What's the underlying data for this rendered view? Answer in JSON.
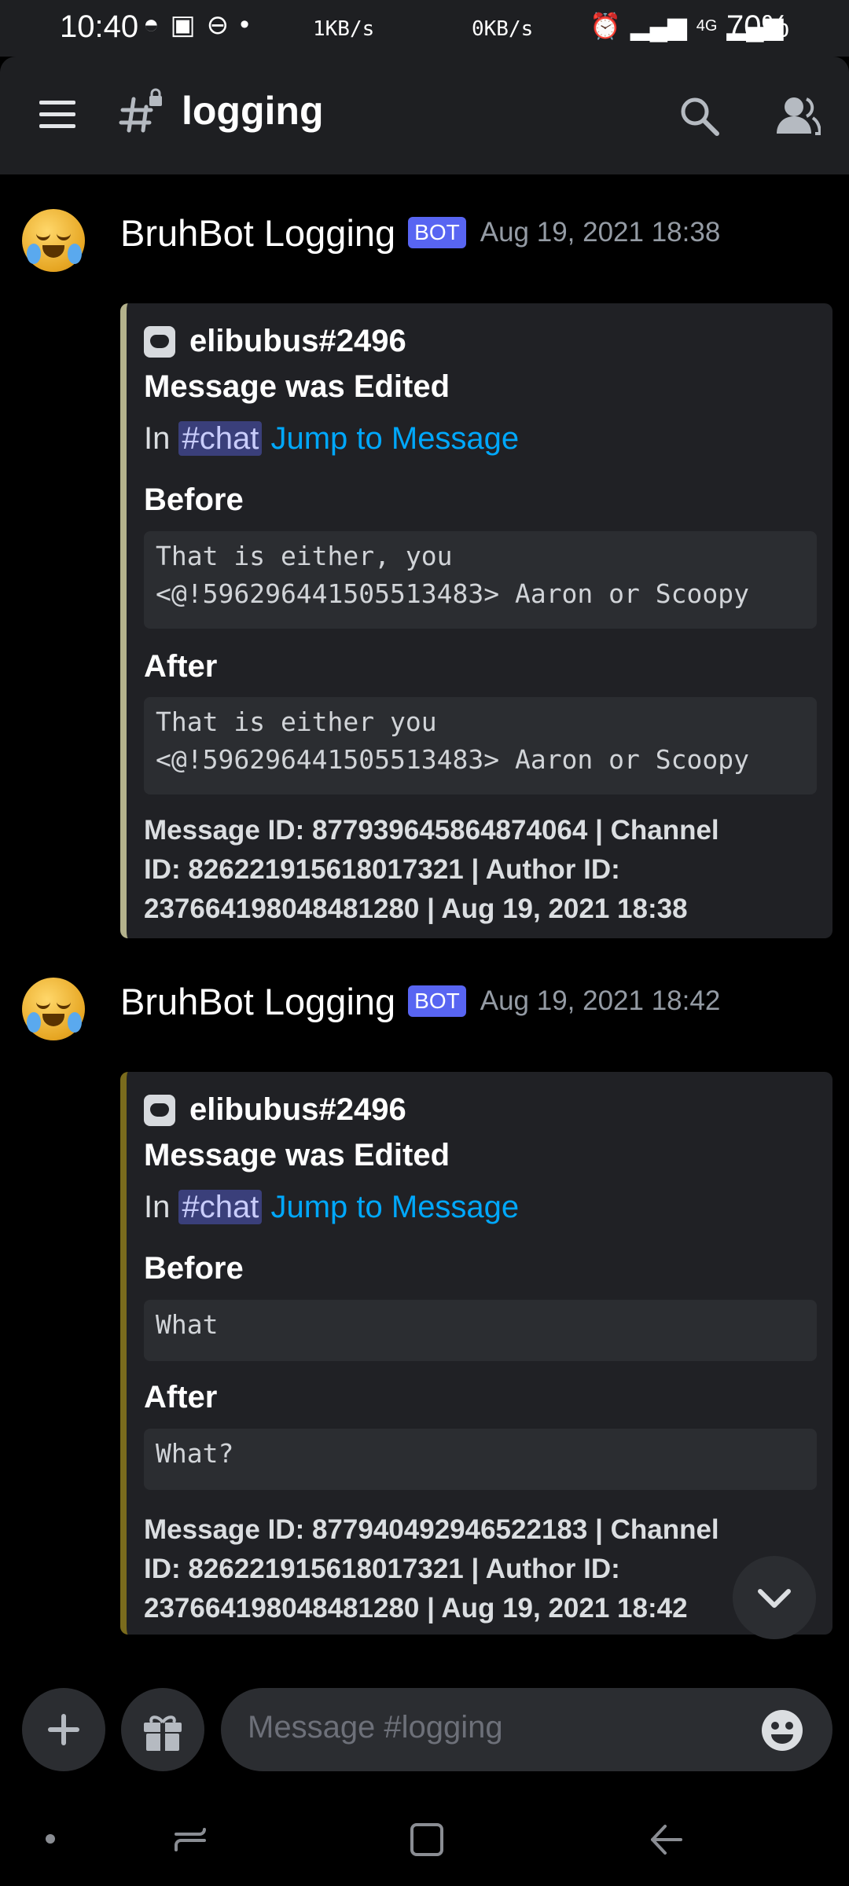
{
  "status_bar": {
    "time": "10:40",
    "net_down": "1KB/s",
    "net_up": "0KB/s",
    "battery": "70%",
    "signal_label": "4G"
  },
  "header": {
    "channel": "logging"
  },
  "messages": [
    {
      "author": "BruhBot Logging",
      "badge": "BOT",
      "time": "Aug 19, 2021 18:38",
      "embed": {
        "author": "elibubus#2496",
        "title": "Message was Edited",
        "in_prefix": "In",
        "channel_mention": "#chat",
        "jump_link": "Jump to Message",
        "before_label": "Before",
        "before_text": "That is either, you\n<@!596296441505513483> Aaron or Scoopy",
        "after_label": "After",
        "after_text": "That is either you\n<@!596296441505513483> Aaron or Scoopy",
        "footer": "Message ID: 877939645864874064 | Channel ID: 826221915618017321 | Author ID: 237664198048481280 | Aug 19, 2021 18:38"
      }
    },
    {
      "author": "BruhBot Logging",
      "badge": "BOT",
      "time": "Aug 19, 2021 18:42",
      "embed": {
        "author": "elibubus#2496",
        "title": "Message was Edited",
        "in_prefix": "In",
        "channel_mention": "#chat",
        "jump_link": "Jump to Message",
        "before_label": "Before",
        "before_text": "What",
        "after_label": "After",
        "after_text": "What?",
        "footer": "Message ID: 877940492946522183 | Channel ID: 826221915618017321 | Author ID: 237664198048481280 | Aug 19, 2021 18:42"
      }
    }
  ],
  "composer": {
    "placeholder": "Message #logging"
  },
  "colors": {
    "background": "#000000",
    "surface": "#1e1f22",
    "embed_bg": "#202125",
    "accent_link": "#00a8fc",
    "bot_badge": "#5865f2",
    "embed_border_1": "#b4b28c",
    "embed_border_2": "#7a6b1d"
  }
}
